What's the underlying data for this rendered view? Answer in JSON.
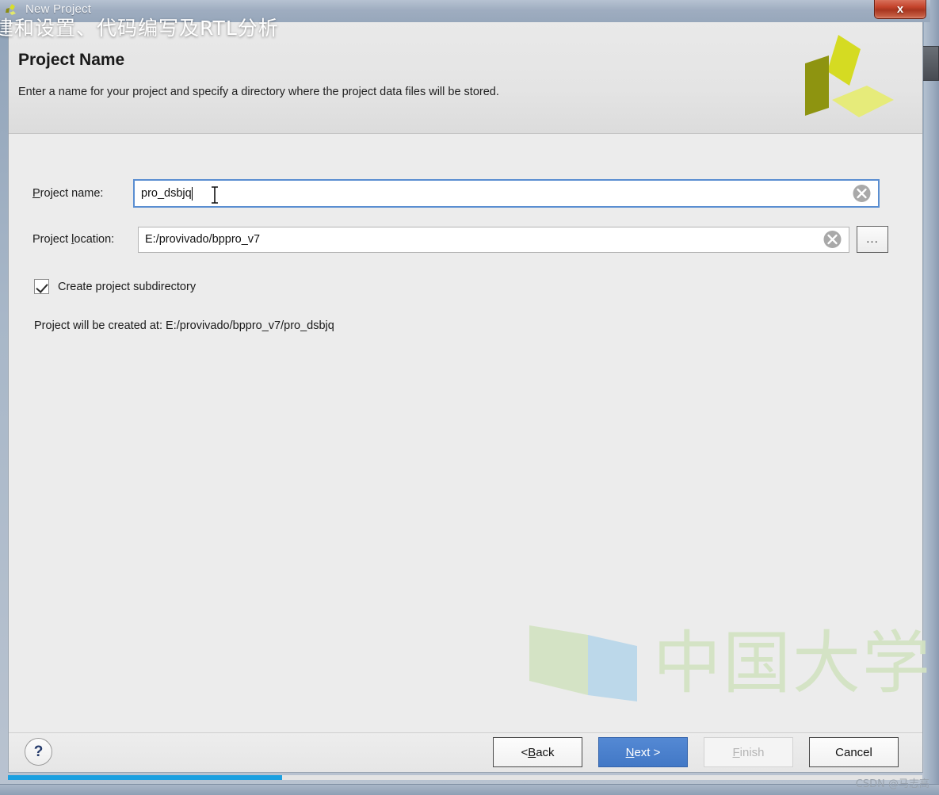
{
  "window": {
    "title": "New Project",
    "title_icon": "xilinx-icon",
    "close_label": "x"
  },
  "overlay": {
    "banner_text": "建和设置、代码编写及RTL分析"
  },
  "header": {
    "title": "Project Name",
    "subtitle": "Enter a name for your project and specify a directory where the project data files will be stored.",
    "logo": "xilinx-logo"
  },
  "form": {
    "project_name": {
      "label_prefix": "P",
      "label_rest": "roject name:",
      "value": "pro_dsbjq",
      "placeholder": "",
      "clear_icon": "clear-circle-icon"
    },
    "project_location": {
      "label_prefix_a": "Project ",
      "label_mnemonic": "l",
      "label_rest": "ocation:",
      "value": "E:/provivado/bppro_v7",
      "placeholder": "",
      "clear_icon": "clear-circle-icon",
      "browse_label": "..."
    },
    "subdirectory": {
      "label": "Create project subdirectory",
      "checked": true
    },
    "created_at": "Project will be created at: E:/provivado/bppro_v7/pro_dsbjq"
  },
  "watermark": {
    "text": "中国大学",
    "logo": "book-icon"
  },
  "footer": {
    "help_label": "?",
    "buttons": [
      {
        "id": "back",
        "prefix": "< ",
        "mnemonic": "B",
        "suffix": "ack",
        "state": "normal"
      },
      {
        "id": "next",
        "prefix": "",
        "mnemonic": "N",
        "suffix": "ext >",
        "state": "primary"
      },
      {
        "id": "finish",
        "prefix": "",
        "mnemonic": "F",
        "suffix": "inish",
        "state": "disabled"
      },
      {
        "id": "cancel",
        "prefix": "",
        "mnemonic": "",
        "suffix": "Cancel",
        "state": "normal"
      }
    ]
  },
  "status": {
    "progress_percent": 30
  },
  "credit": {
    "text": "CSDN @马志高"
  },
  "colors": {
    "accent_blue": "#4278c6",
    "progress_blue": "#1ba0e0",
    "xilinx_yellow": "#cfd41f",
    "close_red": "#c4442c"
  }
}
